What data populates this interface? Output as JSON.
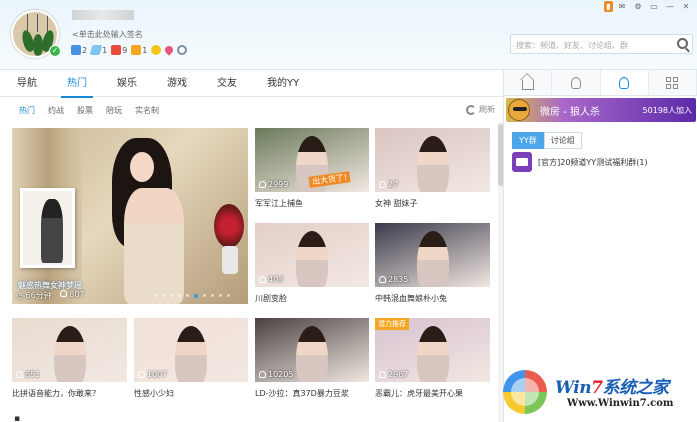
{
  "header": {
    "signature": "<单击此处输入签名",
    "badges": [
      {
        "icon": "diamond-icon",
        "value": "2"
      },
      {
        "icon": "wing-icon",
        "value": "1"
      },
      {
        "icon": "red-badge-icon",
        "value": "9"
      },
      {
        "icon": "crown-icon",
        "value": "1"
      },
      {
        "icon": "coin-icon",
        "value": ""
      },
      {
        "icon": "heart-icon",
        "value": ""
      },
      {
        "icon": "eye-icon",
        "value": ""
      }
    ],
    "search_placeholder": "搜索：频道、好友、讨论组、群"
  },
  "nav": {
    "tabs": [
      "导航",
      "热门",
      "娱乐",
      "游戏",
      "交友",
      "我的YY"
    ],
    "active": "热门"
  },
  "subnav": {
    "tabs": [
      "热门",
      "约战",
      "股票",
      "陪玩",
      "实名制"
    ],
    "active": "热门",
    "refresh": "刷新"
  },
  "featured": {
    "title": "魅惑热舞女神梦瑶",
    "duration": "66分钟",
    "viewers": "807"
  },
  "cards": [
    {
      "caption": "军军江上捕鱼",
      "viewers": "2999",
      "overlay": "出大货了!",
      "bg": "#6b7a5a"
    },
    {
      "caption": "女神 甜妹子",
      "viewers": "27",
      "overlay": "",
      "bg": "#d9c4c0"
    },
    {
      "caption": "川剧变脸",
      "viewers": "403",
      "overlay": "",
      "bg": "#e3cfc8"
    },
    {
      "caption": "中韩混血舞娘朴小兔",
      "viewers": "2835",
      "overlay": "",
      "bg": "#3a3a4a"
    },
    {
      "caption": "比拼语音能力，你敢来？",
      "viewers": "851",
      "overlay": "",
      "bg": "#e8dcd0"
    },
    {
      "caption": "性感小少妇",
      "viewers": "1007",
      "overlay": "",
      "bg": "#f1e1d8"
    },
    {
      "caption": "LD-沙拉：真37D暴力豆浆",
      "viewers": "10205",
      "overlay": "",
      "bg": "#4a4040"
    },
    {
      "caption": "恶霸儿：虎牙最美开心果",
      "viewers": "2967",
      "overlay": "潜力推荐",
      "bg": "#d6c2d0"
    }
  ],
  "right_panel": {
    "weifang_title": "微房 - 狼人杀",
    "weifang_count": "50198人加入",
    "group_tabs": [
      "YY群",
      "讨论组"
    ],
    "group_active": "YY群",
    "group_item": "[官方]20频道YY测试福利群(1)"
  },
  "watermark": {
    "brand_pre": "Win",
    "brand_seven": "7",
    "brand_post": "系统之家",
    "url": "Www.Winwin7.com"
  },
  "colors": {
    "accent": "#1a8ad8",
    "header_bg": "#eaf5fb",
    "weifang_gradient_end": "#5b2aa8"
  }
}
